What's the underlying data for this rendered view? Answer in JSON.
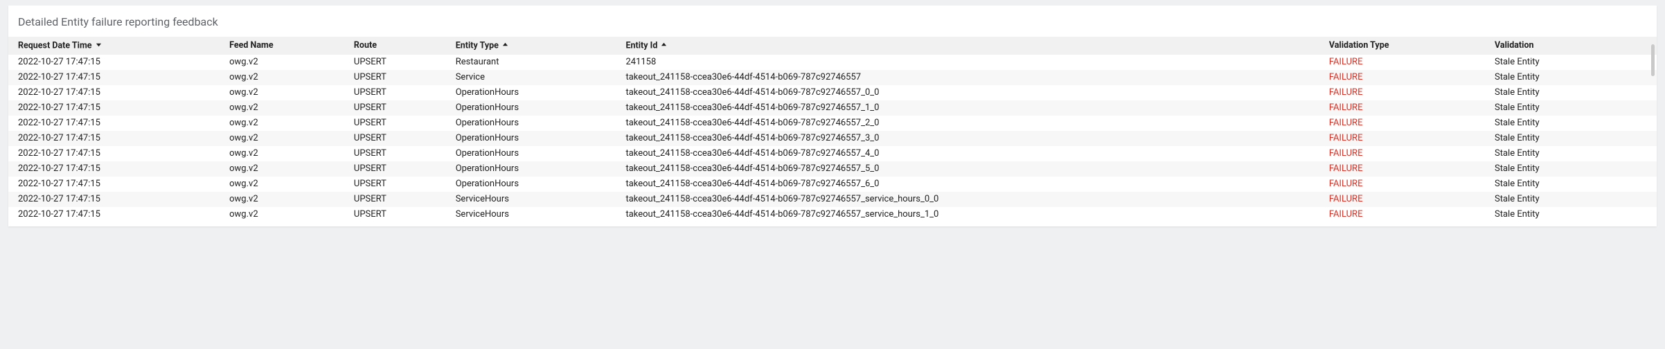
{
  "title": "Detailed Entity failure reporting feedback",
  "columns": {
    "request_date_time": "Request Date Time",
    "feed_name": "Feed Name",
    "route": "Route",
    "entity_type": "Entity Type",
    "entity_id": "Entity Id",
    "validation_type": "Validation Type",
    "validation": "Validation"
  },
  "sort": {
    "request_date_time": "desc",
    "entity_type": "asc",
    "entity_id": "asc"
  },
  "rows": [
    {
      "request_date_time": "2022-10-27 17:47:15",
      "feed_name": "owg.v2",
      "route": "UPSERT",
      "entity_type": "Restaurant",
      "entity_id": "241158",
      "validation_type": "FAILURE",
      "validation": "Stale Entity"
    },
    {
      "request_date_time": "2022-10-27 17:47:15",
      "feed_name": "owg.v2",
      "route": "UPSERT",
      "entity_type": "Service",
      "entity_id": "takeout_241158-ccea30e6-44df-4514-b069-787c92746557",
      "validation_type": "FAILURE",
      "validation": "Stale Entity"
    },
    {
      "request_date_time": "2022-10-27 17:47:15",
      "feed_name": "owg.v2",
      "route": "UPSERT",
      "entity_type": "OperationHours",
      "entity_id": "takeout_241158-ccea30e6-44df-4514-b069-787c92746557_0_0",
      "validation_type": "FAILURE",
      "validation": "Stale Entity"
    },
    {
      "request_date_time": "2022-10-27 17:47:15",
      "feed_name": "owg.v2",
      "route": "UPSERT",
      "entity_type": "OperationHours",
      "entity_id": "takeout_241158-ccea30e6-44df-4514-b069-787c92746557_1_0",
      "validation_type": "FAILURE",
      "validation": "Stale Entity"
    },
    {
      "request_date_time": "2022-10-27 17:47:15",
      "feed_name": "owg.v2",
      "route": "UPSERT",
      "entity_type": "OperationHours",
      "entity_id": "takeout_241158-ccea30e6-44df-4514-b069-787c92746557_2_0",
      "validation_type": "FAILURE",
      "validation": "Stale Entity"
    },
    {
      "request_date_time": "2022-10-27 17:47:15",
      "feed_name": "owg.v2",
      "route": "UPSERT",
      "entity_type": "OperationHours",
      "entity_id": "takeout_241158-ccea30e6-44df-4514-b069-787c92746557_3_0",
      "validation_type": "FAILURE",
      "validation": "Stale Entity"
    },
    {
      "request_date_time": "2022-10-27 17:47:15",
      "feed_name": "owg.v2",
      "route": "UPSERT",
      "entity_type": "OperationHours",
      "entity_id": "takeout_241158-ccea30e6-44df-4514-b069-787c92746557_4_0",
      "validation_type": "FAILURE",
      "validation": "Stale Entity"
    },
    {
      "request_date_time": "2022-10-27 17:47:15",
      "feed_name": "owg.v2",
      "route": "UPSERT",
      "entity_type": "OperationHours",
      "entity_id": "takeout_241158-ccea30e6-44df-4514-b069-787c92746557_5_0",
      "validation_type": "FAILURE",
      "validation": "Stale Entity"
    },
    {
      "request_date_time": "2022-10-27 17:47:15",
      "feed_name": "owg.v2",
      "route": "UPSERT",
      "entity_type": "OperationHours",
      "entity_id": "takeout_241158-ccea30e6-44df-4514-b069-787c92746557_6_0",
      "validation_type": "FAILURE",
      "validation": "Stale Entity"
    },
    {
      "request_date_time": "2022-10-27 17:47:15",
      "feed_name": "owg.v2",
      "route": "UPSERT",
      "entity_type": "ServiceHours",
      "entity_id": "takeout_241158-ccea30e6-44df-4514-b069-787c92746557_service_hours_0_0",
      "validation_type": "FAILURE",
      "validation": "Stale Entity"
    },
    {
      "request_date_time": "2022-10-27 17:47:15",
      "feed_name": "owg.v2",
      "route": "UPSERT",
      "entity_type": "ServiceHours",
      "entity_id": "takeout_241158-ccea30e6-44df-4514-b069-787c92746557_service_hours_1_0",
      "validation_type": "FAILURE",
      "validation": "Stale Entity"
    }
  ]
}
